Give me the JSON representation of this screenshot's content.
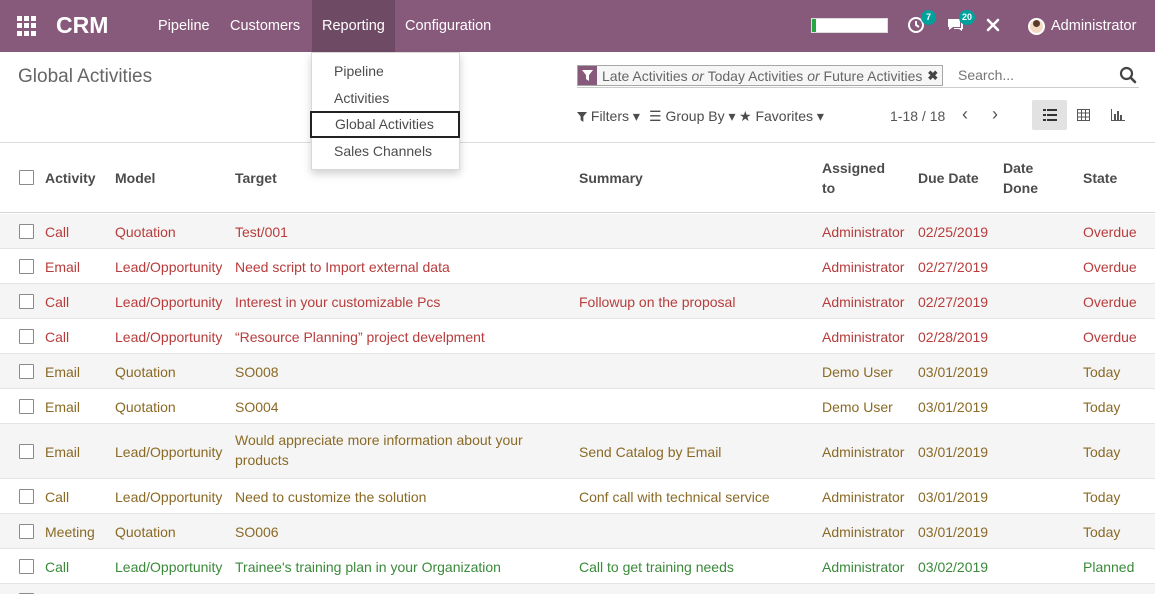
{
  "navbar": {
    "brand": "CRM",
    "menu": [
      "Pipeline",
      "Customers",
      "Reporting",
      "Configuration"
    ],
    "chat_badge": "7",
    "messages_badge": "20",
    "user": "Administrator",
    "progress_fraction": 0.05
  },
  "dropdown": {
    "items": [
      "Pipeline",
      "Activities",
      "Global Activities",
      "Sales Channels"
    ]
  },
  "control": {
    "title": "Global Activities",
    "facet_parts": [
      "Late Activities",
      "or",
      "Today Activities",
      "or",
      "Future Activities"
    ],
    "search_placeholder": "Search...",
    "filters": "Filters",
    "group_by": "Group By",
    "favorites": "Favorites",
    "pager": "1-18 / 18"
  },
  "columns": [
    "Activity",
    "Model",
    "Target",
    "Summary",
    "Assigned to",
    "Due Date",
    "Date Done",
    "State"
  ],
  "rows": [
    {
      "activity": "Call",
      "model": "Quotation",
      "target": "Test/001",
      "summary": "",
      "assigned": "Administrator",
      "due": "02/25/2019",
      "done": "",
      "state": "Overdue"
    },
    {
      "activity": "Email",
      "model": "Lead/Opportunity",
      "target": "Need script to Import external data",
      "summary": "",
      "assigned": "Administrator",
      "due": "02/27/2019",
      "done": "",
      "state": "Overdue"
    },
    {
      "activity": "Call",
      "model": "Lead/Opportunity",
      "target": "Interest in your customizable Pcs",
      "summary": "Followup on the proposal",
      "assigned": "Administrator",
      "due": "02/27/2019",
      "done": "",
      "state": "Overdue"
    },
    {
      "activity": "Call",
      "model": "Lead/Opportunity",
      "target": "“Resource Planning” project develpment",
      "summary": "",
      "assigned": "Administrator",
      "due": "02/28/2019",
      "done": "",
      "state": "Overdue"
    },
    {
      "activity": "Email",
      "model": "Quotation",
      "target": "SO008",
      "summary": "",
      "assigned": "Demo User",
      "due": "03/01/2019",
      "done": "",
      "state": "Today"
    },
    {
      "activity": "Email",
      "model": "Quotation",
      "target": "SO004",
      "summary": "",
      "assigned": "Demo User",
      "due": "03/01/2019",
      "done": "",
      "state": "Today"
    },
    {
      "activity": "Email",
      "model": "Lead/Opportunity",
      "target": "Would appreciate more information about your products",
      "summary": "Send Catalog by Email",
      "assigned": "Administrator",
      "due": "03/01/2019",
      "done": "",
      "state": "Today"
    },
    {
      "activity": "Call",
      "model": "Lead/Opportunity",
      "target": "Need to customize the solution",
      "summary": "Conf call with technical service",
      "assigned": "Administrator",
      "due": "03/01/2019",
      "done": "",
      "state": "Today"
    },
    {
      "activity": "Meeting",
      "model": "Quotation",
      "target": "SO006",
      "summary": "",
      "assigned": "Administrator",
      "due": "03/01/2019",
      "done": "",
      "state": "Today"
    },
    {
      "activity": "Call",
      "model": "Lead/Opportunity",
      "target": "Trainee's training plan in your Organization",
      "summary": "Call to get training needs",
      "assigned": "Administrator",
      "due": "03/02/2019",
      "done": "",
      "state": "Planned"
    }
  ],
  "colors": {
    "brand": "#875a7b",
    "overdue": "#b83c3c",
    "today": "#8a6a25",
    "planned": "#3a8a3a"
  },
  "icons": {
    "apps": "apps-grid-icon",
    "activity": "clock-icon",
    "messages": "chat-icon",
    "debug": "cross-tools-icon",
    "filter": "funnel-icon",
    "search": "magnifier-icon"
  }
}
